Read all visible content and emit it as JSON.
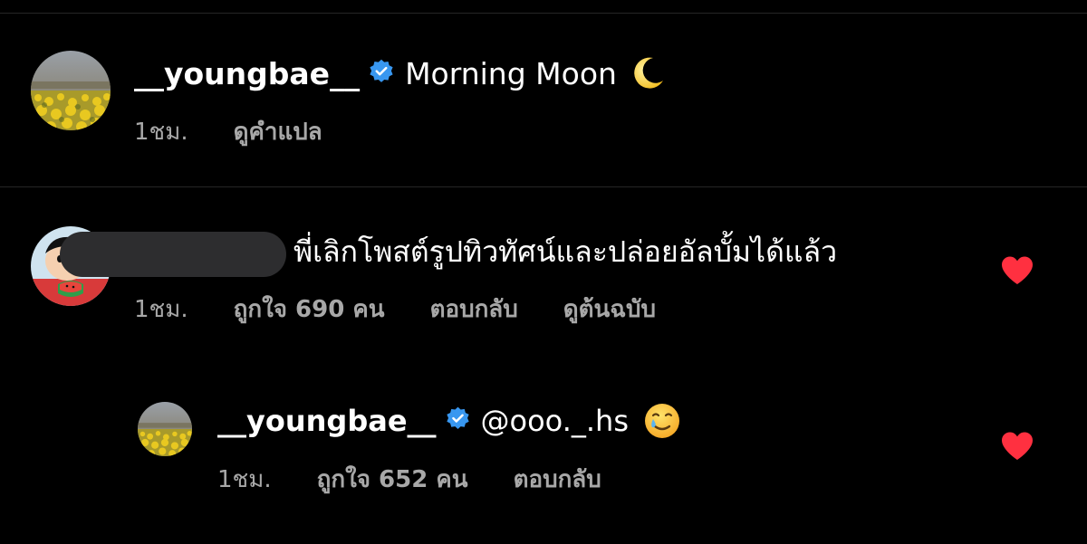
{
  "colors": {
    "background": "#000000",
    "text_primary": "#ffffff",
    "text_secondary": "#a8a8a8",
    "verified_blue": "#3897f0",
    "like_red": "#ff3040",
    "divider": "#262626"
  },
  "post_caption": {
    "username": "__youngbae__",
    "verified_icon": "verified-badge-icon",
    "text": "Morning Moon",
    "emoji": "🌙",
    "time": "1ชม.",
    "translate_label": "ดูคำแปล"
  },
  "comment": {
    "username_redacted": true,
    "text": "พี่เลิกโพสต์รูปทิวทัศน์และปล่อยอัลบั้มได้แล้ว",
    "time": "1ชม.",
    "likes_label": "ถูกใจ 690 คน",
    "reply_label": "ตอบกลับ",
    "see_original_label": "ดูต้นฉบับ",
    "liked": true,
    "heart_icon": "heart-filled-icon"
  },
  "reply": {
    "username": "__youngbae__",
    "verified_icon": "verified-badge-icon",
    "mention": "@ooo._.hs",
    "emoji": "🥲",
    "time": "1ชม.",
    "likes_label": "ถูกใจ 652 คน",
    "reply_label": "ตอบกลับ",
    "liked": true,
    "heart_icon": "heart-filled-icon"
  }
}
